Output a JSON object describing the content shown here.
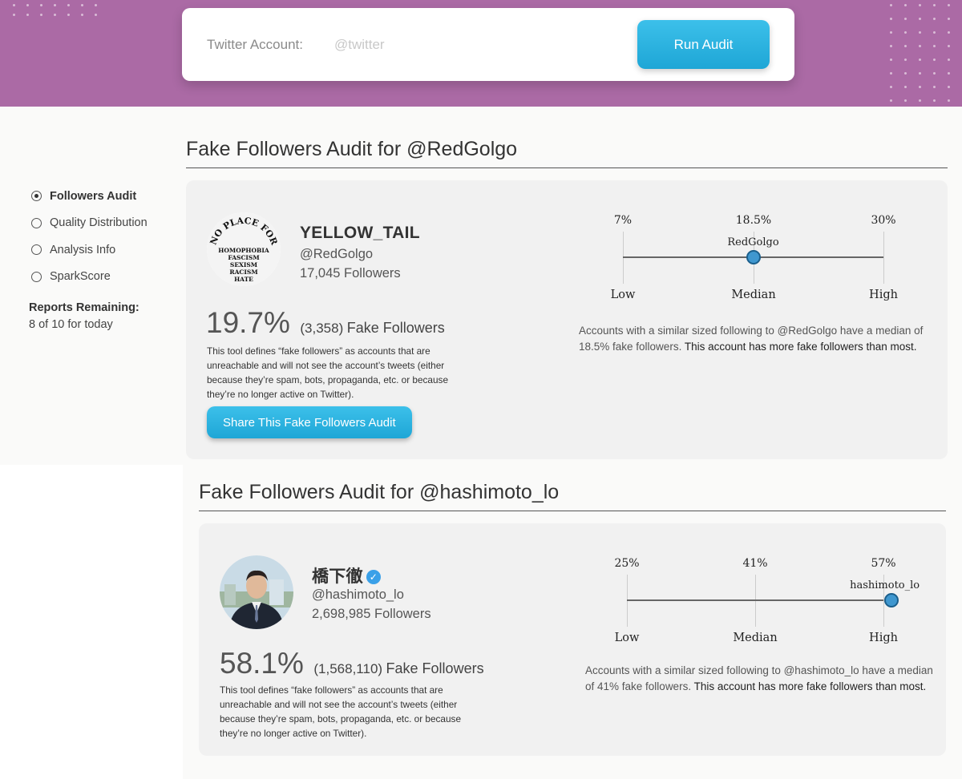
{
  "header": {
    "search_label": "Twitter Account:",
    "search_placeholder": "@twitter",
    "run_button": "Run Audit"
  },
  "sidebar": {
    "items": [
      {
        "label": "Followers Audit",
        "active": true
      },
      {
        "label": "Quality Distribution",
        "active": false
      },
      {
        "label": "Analysis Info",
        "active": false
      },
      {
        "label": "SparkScore",
        "active": false
      }
    ],
    "reports_title": "Reports Remaining:",
    "reports_value": "8 of 10 for today"
  },
  "audits": [
    {
      "title": "Fake Followers Audit for @RedGolgo",
      "name": "YELLOW_TAIL",
      "verified": false,
      "handle": "@RedGolgo",
      "followers": "17,045 Followers",
      "avatar_text": [
        "NO PLACE FOR",
        "HOMOPHOBIA",
        "FASCISM",
        "SEXISM",
        "RACISM",
        "HATE"
      ],
      "fake_pct": "19.7%",
      "fake_count": "(3,358)",
      "fake_label": "Fake Followers",
      "definition": "This tool defines “fake followers” as accounts that are unreachable and will not see the account’s tweets (either because they’re spam, bots, propaganda, etc. or because they’re no longer active on Twitter).",
      "share_button": "Share This Fake Followers Audit",
      "scale": {
        "low_value": "7%",
        "median_value": "18.5%",
        "high_value": "30%",
        "low_label": "Low",
        "median_label": "Median",
        "high_label": "High",
        "marker_label": "RedGolgo",
        "position": 0.5
      },
      "compare_text": "Accounts with a similar sized following to @RedGolgo have a median of 18.5% fake followers.",
      "compare_strong": "This account has more fake followers than most."
    },
    {
      "title": "Fake Followers Audit for @hashimoto_lo",
      "name": "橋下徹",
      "verified": true,
      "handle": "@hashimoto_lo",
      "followers": "2,698,985 Followers",
      "fake_pct": "58.1%",
      "fake_count": "(1,568,110)",
      "fake_label": "Fake Followers",
      "definition": "This tool defines “fake followers” as accounts that are unreachable and will not see the account’s tweets (either because they’re spam, bots, propaganda, etc. or because they’re no longer active on Twitter).",
      "scale": {
        "low_value": "25%",
        "median_value": "41%",
        "high_value": "57%",
        "low_label": "Low",
        "median_label": "Median",
        "high_label": "High",
        "marker_label": "hashimoto_lo",
        "position": 1.03
      },
      "compare_text": "Accounts with a similar sized following to @hashimoto_lo have a median of 41% fake followers.",
      "compare_strong": "This account has more fake followers than most."
    }
  ],
  "colors": {
    "header_bg": "#ab6aa5",
    "button_blue": "#1ea6d6",
    "marker_blue": "#3f97cf"
  }
}
